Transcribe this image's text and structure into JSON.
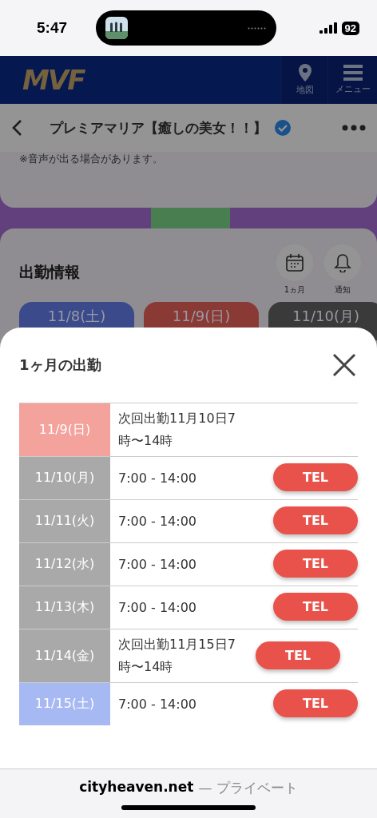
{
  "status_bar": {
    "time": "5:47",
    "battery": "92"
  },
  "site_header": {
    "logo": "MVF",
    "map_label": "地図",
    "menu_label": "メニュー"
  },
  "page": {
    "title": "プレミアマリア【癒しの美女！！】",
    "notice": "※音声が出る場合があります。",
    "section_title": "出勤情報",
    "month_label": "1ヵ月",
    "notify_label": "通知",
    "date_chips": [
      {
        "label": "11/8(土)",
        "color": "#3a4a8a"
      },
      {
        "label": "11/9(日)",
        "color": "#8a3a35"
      },
      {
        "label": "11/10(月)",
        "color": "#3a3a3a"
      }
    ]
  },
  "sheet": {
    "title": "1ヶ月の出勤",
    "rows": [
      {
        "date": "11/9(日)",
        "color": "#f4a29c",
        "text": "次回出勤11月10日7時〜14時"
      },
      {
        "date": "11/10(月)",
        "color": "#a9a9a9",
        "text": "7:00 - 14:00",
        "tel": "TEL"
      },
      {
        "date": "11/11(火)",
        "color": "#a9a9a9",
        "text": "7:00 - 14:00",
        "tel": "TEL"
      },
      {
        "date": "11/12(水)",
        "color": "#a9a9a9",
        "text": "7:00 - 14:00",
        "tel": "TEL"
      },
      {
        "date": "11/13(木)",
        "color": "#a9a9a9",
        "text": "7:00 - 14:00",
        "tel": "TEL"
      },
      {
        "date": "11/14(金)",
        "color": "#a9a9a9",
        "text": "次回出勤11月15日7時〜14時",
        "tel": "TEL"
      },
      {
        "date": "11/15(土)",
        "color": "#a6b9f2",
        "text": "7:00 - 14:00",
        "tel": "TEL"
      }
    ]
  },
  "browser_bar": {
    "domain": "cityheaven.net",
    "suffix": "— プライベート"
  }
}
